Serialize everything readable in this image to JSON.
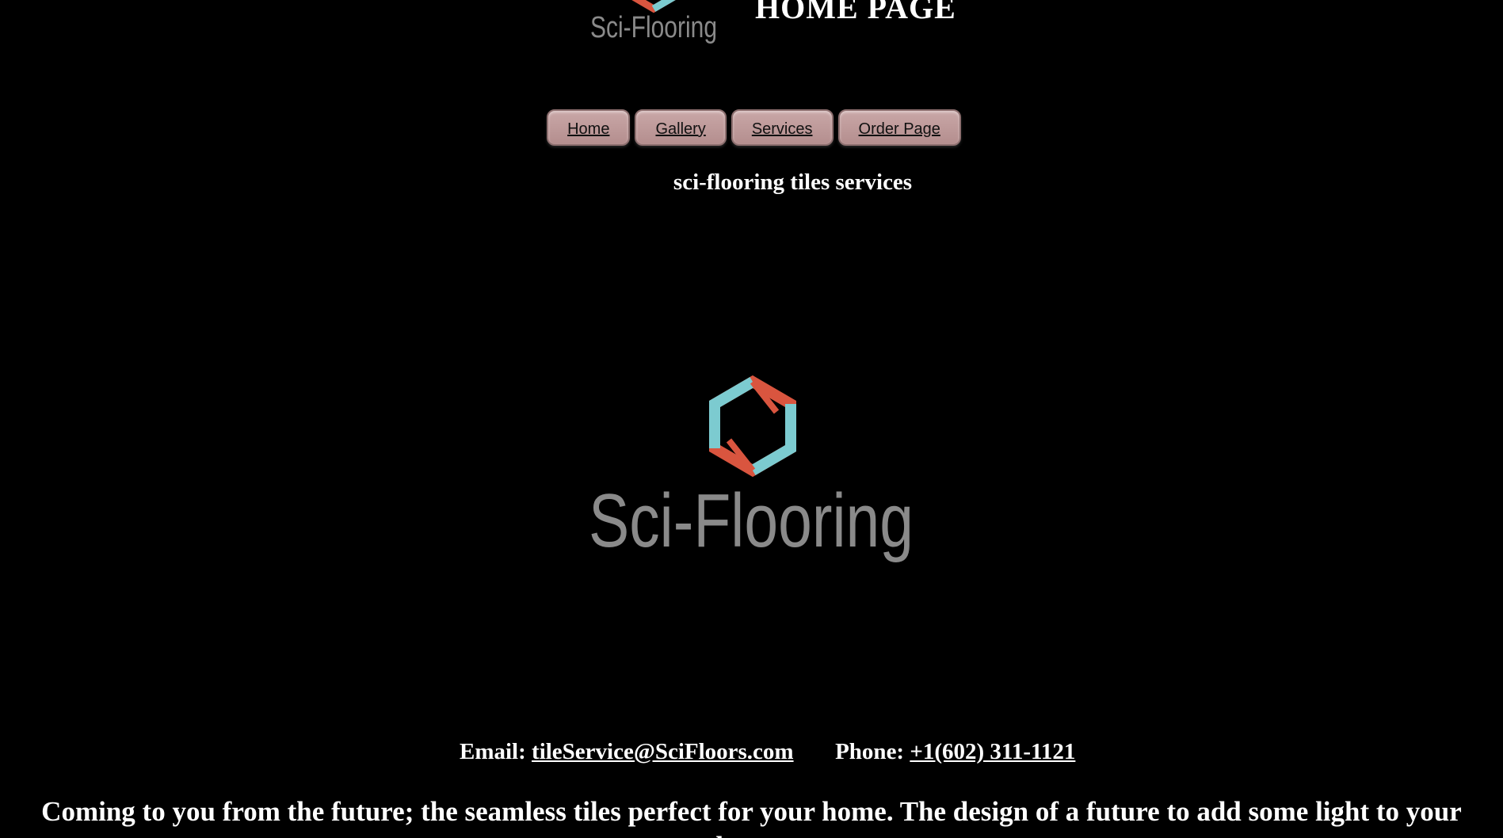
{
  "header": {
    "logo_text": "Sci-Flooring",
    "title": "HOME PAGE"
  },
  "nav": {
    "items": [
      {
        "label": "Home"
      },
      {
        "label": "Gallery"
      },
      {
        "label": "Services"
      },
      {
        "label": "Order Page"
      }
    ]
  },
  "tagline": "sci-flooring tiles services",
  "hero": {
    "logo_text": "Sci-Flooring"
  },
  "contact": {
    "email_label": "Email:",
    "email": "tileService@SciFloors.com",
    "phone_label": "Phone:",
    "phone": "+1(602) 311-1121"
  },
  "blurb": "Coming to you from the future; the seamless tiles perfect for your home. The design of a future to add some light to your home.",
  "colors": {
    "background": "#000000",
    "text": "#ffffff",
    "nav_button": "#c4a0a0",
    "logo_red": "#d9553f",
    "logo_teal": "#7ccbd0",
    "logo_text": "#8a8a8a"
  }
}
